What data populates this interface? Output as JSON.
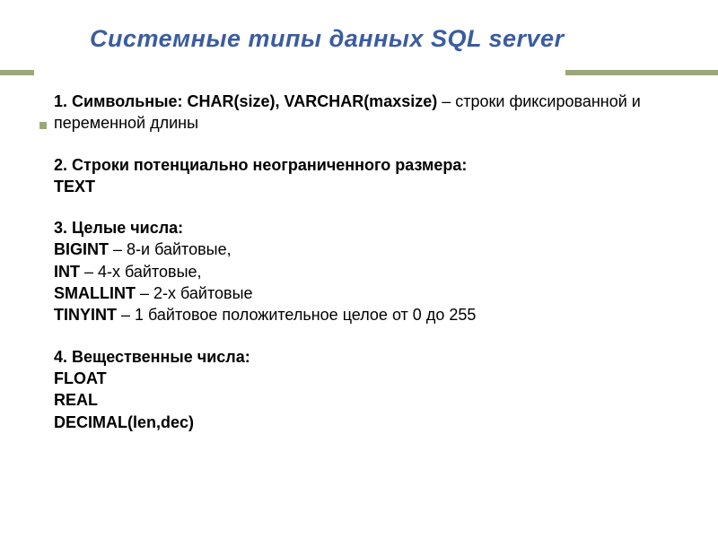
{
  "title": "Системные типы данных SQL server",
  "sections": {
    "s1": {
      "lead_bold": "1. Символьные: CHAR(size), VARCHAR(maxsize)",
      "lead_rest": " – строки фиксированной и переменной длины"
    },
    "s2": {
      "line1_bold": "2. Строки потенциально неограниченного размера:",
      "line2_bold": "TEXT"
    },
    "s3": {
      "line1_bold": "3. Целые числа:",
      "l2_bold": "BIGINT",
      "l2_rest": " – 8-и байтовые,",
      "l3_bold": "INT",
      "l3_rest": " – 4-х байтовые,",
      "l4_bold": "SMALLINT",
      "l4_rest": " – 2-х байтовые",
      "l5_bold": "TINYINT",
      "l5_rest": " – 1 байтовое положительное целое от 0 до 255"
    },
    "s4": {
      "line1_bold": "4. Вещественные числа:",
      "l2_bold": "FLOAT",
      "l3_bold": "REAL",
      "l4_bold": "DECIMAL(len,dec)"
    }
  }
}
